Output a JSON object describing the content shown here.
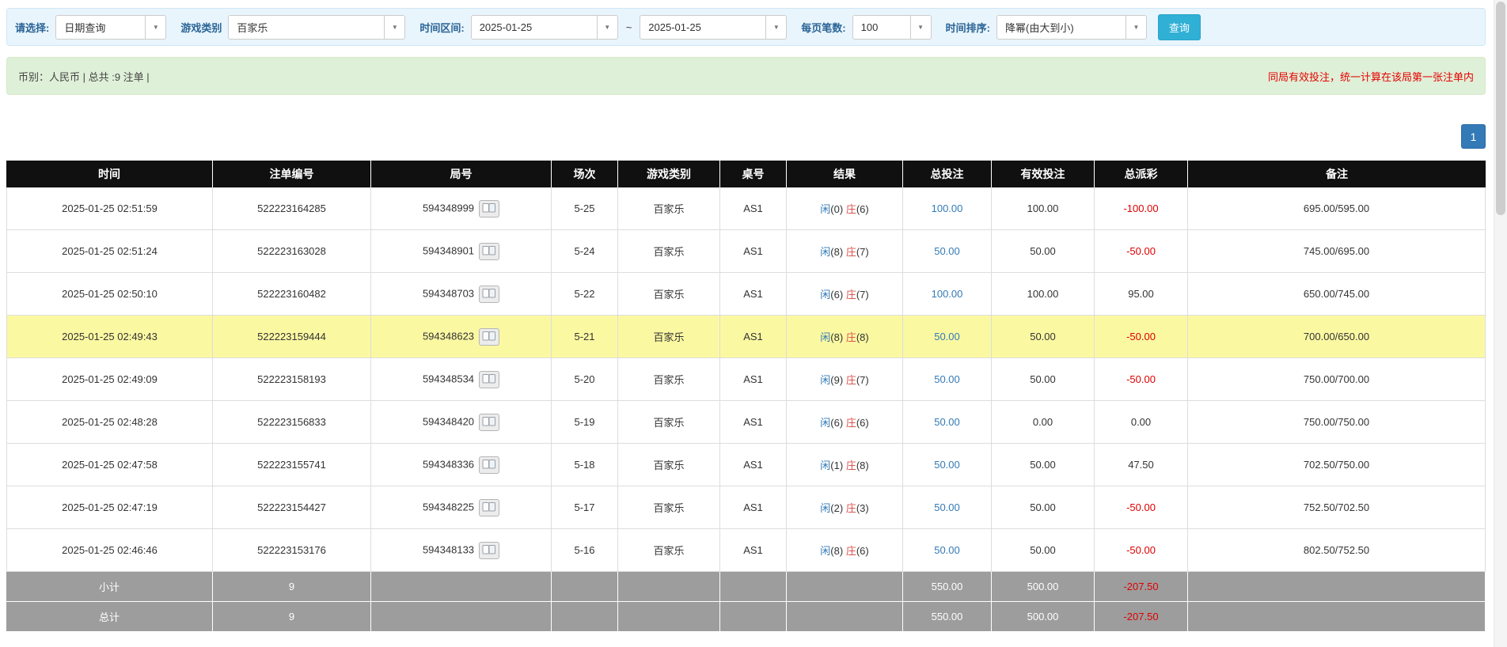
{
  "colors": {
    "accent_blue": "#337ab7",
    "banker_red": "#d9534f",
    "negative_red": "#dd0000",
    "notice_red": "#e60000",
    "highlight_yellow": "#fbf8a2",
    "header_bg": "#101010",
    "footer_bg": "#9d9d9d",
    "button_cyan": "#31b0d5",
    "filter_bg": "#e9f5fc",
    "info_bg": "#dff0d8"
  },
  "icons": {
    "dropdown_caret": "▼"
  },
  "filter_bar": {
    "select_label": "请选择:",
    "select_value": "日期查询",
    "game_type_label": "游戏类别",
    "game_type_value": "百家乐",
    "date_range_label": "时间区间:",
    "date_from": "2025-01-25",
    "date_separator": "~",
    "date_to": "2025-01-25",
    "page_size_label": "每页笔数:",
    "page_size_value": "100",
    "sort_label": "时间排序:",
    "sort_value": "降幂(由大到小)",
    "search_button": "查询"
  },
  "info_bar": {
    "summary": "币别：人民币 | 总共 :9 注单 |",
    "notice": "同局有效投注，统一计算在该局第一张注单内"
  },
  "pagination": {
    "current_page": "1"
  },
  "table": {
    "headers": [
      "时间",
      "注单编号",
      "局号",
      "场次",
      "游戏类别",
      "桌号",
      "结果",
      "总投注",
      "有效投注",
      "总派彩",
      "备注"
    ],
    "rows": [
      {
        "time": "2025-01-25 02:51:59",
        "bet_id": "522223164285",
        "round_id": "594348999",
        "session": "5-25",
        "game": "百家乐",
        "table_no": "AS1",
        "player": "闲(0)",
        "banker": "庄(6)",
        "total_bet": "100.00",
        "valid_bet": "100.00",
        "payout": "-100.00",
        "note": "695.00/595.00",
        "highlight": false
      },
      {
        "time": "2025-01-25 02:51:24",
        "bet_id": "522223163028",
        "round_id": "594348901",
        "session": "5-24",
        "game": "百家乐",
        "table_no": "AS1",
        "player": "闲(8)",
        "banker": "庄(7)",
        "total_bet": "50.00",
        "valid_bet": "50.00",
        "payout": "-50.00",
        "note": "745.00/695.00",
        "highlight": false
      },
      {
        "time": "2025-01-25 02:50:10",
        "bet_id": "522223160482",
        "round_id": "594348703",
        "session": "5-22",
        "game": "百家乐",
        "table_no": "AS1",
        "player": "闲(6)",
        "banker": "庄(7)",
        "total_bet": "100.00",
        "valid_bet": "100.00",
        "payout": "95.00",
        "note": "650.00/745.00",
        "highlight": false
      },
      {
        "time": "2025-01-25 02:49:43",
        "bet_id": "522223159444",
        "round_id": "594348623",
        "session": "5-21",
        "game": "百家乐",
        "table_no": "AS1",
        "player": "闲(8)",
        "banker": "庄(8)",
        "total_bet": "50.00",
        "valid_bet": "50.00",
        "payout": "-50.00",
        "note": "700.00/650.00",
        "highlight": true
      },
      {
        "time": "2025-01-25 02:49:09",
        "bet_id": "522223158193",
        "round_id": "594348534",
        "session": "5-20",
        "game": "百家乐",
        "table_no": "AS1",
        "player": "闲(9)",
        "banker": "庄(7)",
        "total_bet": "50.00",
        "valid_bet": "50.00",
        "payout": "-50.00",
        "note": "750.00/700.00",
        "highlight": false
      },
      {
        "time": "2025-01-25 02:48:28",
        "bet_id": "522223156833",
        "round_id": "594348420",
        "session": "5-19",
        "game": "百家乐",
        "table_no": "AS1",
        "player": "闲(6)",
        "banker": "庄(6)",
        "total_bet": "50.00",
        "valid_bet": "0.00",
        "payout": "0.00",
        "note": "750.00/750.00",
        "highlight": false
      },
      {
        "time": "2025-01-25 02:47:58",
        "bet_id": "522223155741",
        "round_id": "594348336",
        "session": "5-18",
        "game": "百家乐",
        "table_no": "AS1",
        "player": "闲(1)",
        "banker": "庄(8)",
        "total_bet": "50.00",
        "valid_bet": "50.00",
        "payout": "47.50",
        "note": "702.50/750.00",
        "highlight": false
      },
      {
        "time": "2025-01-25 02:47:19",
        "bet_id": "522223154427",
        "round_id": "594348225",
        "session": "5-17",
        "game": "百家乐",
        "table_no": "AS1",
        "player": "闲(2)",
        "banker": "庄(3)",
        "total_bet": "50.00",
        "valid_bet": "50.00",
        "payout": "-50.00",
        "note": "752.50/702.50",
        "highlight": false
      },
      {
        "time": "2025-01-25 02:46:46",
        "bet_id": "522223153176",
        "round_id": "594348133",
        "session": "5-16",
        "game": "百家乐",
        "table_no": "AS1",
        "player": "闲(8)",
        "banker": "庄(6)",
        "total_bet": "50.00",
        "valid_bet": "50.00",
        "payout": "-50.00",
        "note": "802.50/752.50",
        "highlight": false
      }
    ],
    "subtotal": {
      "label": "小计",
      "count": "9",
      "total_bet": "550.00",
      "valid_bet": "500.00",
      "payout": "-207.50"
    },
    "total": {
      "label": "总计",
      "count": "9",
      "total_bet": "550.00",
      "valid_bet": "500.00",
      "payout": "-207.50"
    }
  }
}
